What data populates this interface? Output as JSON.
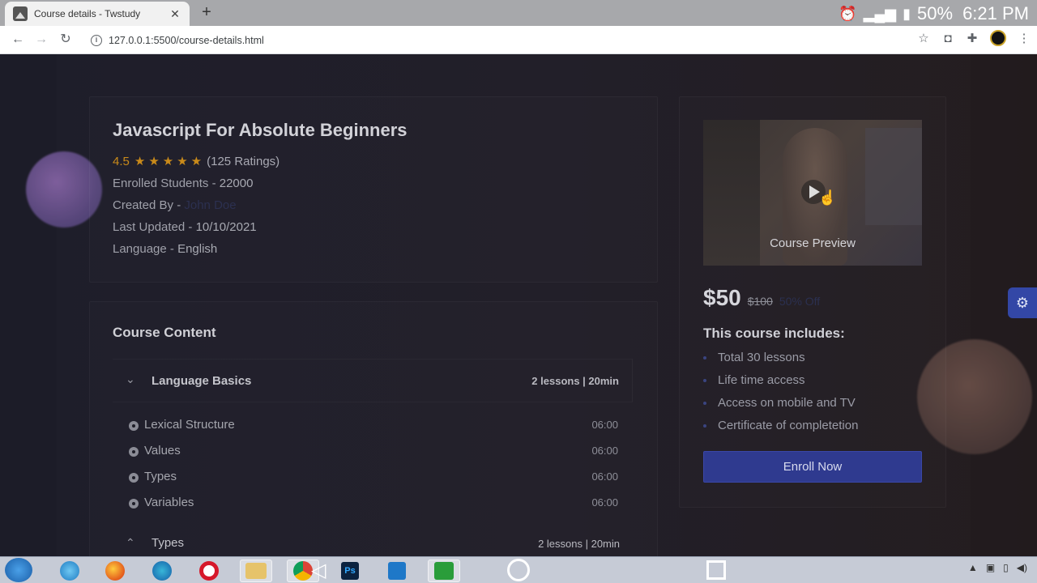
{
  "browser": {
    "tab_title": "Course details - Twstudy",
    "tab_close": "✕",
    "new_tab": "+",
    "url": "127.0.0.1:5500/course-details.html",
    "status_battery": "50%",
    "status_time": "6:21 PM"
  },
  "course": {
    "title": "Javascript For Absolute Beginners",
    "rating": "4.5",
    "ratings_count": "(125 Ratings)",
    "stars": 5,
    "enrolled_label": "Enrolled Students -",
    "enrolled_value": "22000",
    "created_label": "Created By -",
    "created_value": "John Doe",
    "updated_label": "Last Updated -",
    "updated_value": "10/10/2021",
    "language_label": "Language -",
    "language_value": "English"
  },
  "content": {
    "title": "Course Content",
    "sections": [
      {
        "title": "Language Basics",
        "meta": "2 lessons | 20min",
        "lessons": [
          {
            "name": "Lexical Structure",
            "time": "06:00"
          },
          {
            "name": "Values",
            "time": "06:00"
          },
          {
            "name": "Types",
            "time": "06:00"
          },
          {
            "name": "Variables",
            "time": "06:00"
          }
        ]
      },
      {
        "title": "Types",
        "meta": "2 lessons | 20min"
      }
    ]
  },
  "sidebar": {
    "preview_label": "Course Preview",
    "price": "$50",
    "old_price": "$100",
    "discount": "50% Off",
    "includes_title": "This course includes:",
    "includes": [
      "Total 30 lessons",
      "Life time access",
      "Access on mobile and TV",
      "Certificate of completetion"
    ],
    "enroll_label": "Enroll Now"
  },
  "taskbar": {
    "ps_label": "Ps"
  },
  "colors": {
    "accent": "#2f3a8f",
    "star": "#c98a1a"
  }
}
